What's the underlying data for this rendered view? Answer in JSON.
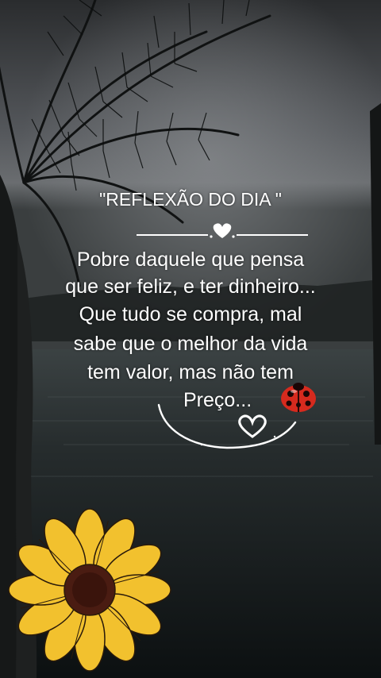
{
  "quote": {
    "title": "\"REFLEXÃO DO DIA \"",
    "lines": [
      "Pobre  daquele que  pensa",
      "que ser feliz, e ter dinheiro...",
      "Que tudo se compra,  mal",
      "sabe que o melhor da vida",
      "tem valor, mas  não  tem",
      "Preço..."
    ]
  },
  "decorations": [
    "heart-divider",
    "ladybug",
    "heart-swirl",
    "sunflower",
    "palm-tree"
  ],
  "colors": {
    "text": "#ffffff",
    "sky": "#5a5d61",
    "water": "#1c2223",
    "sunflower_petal": "#f2c12e",
    "sunflower_center": "#4a1c12",
    "ladybug": "#d62a1e"
  }
}
